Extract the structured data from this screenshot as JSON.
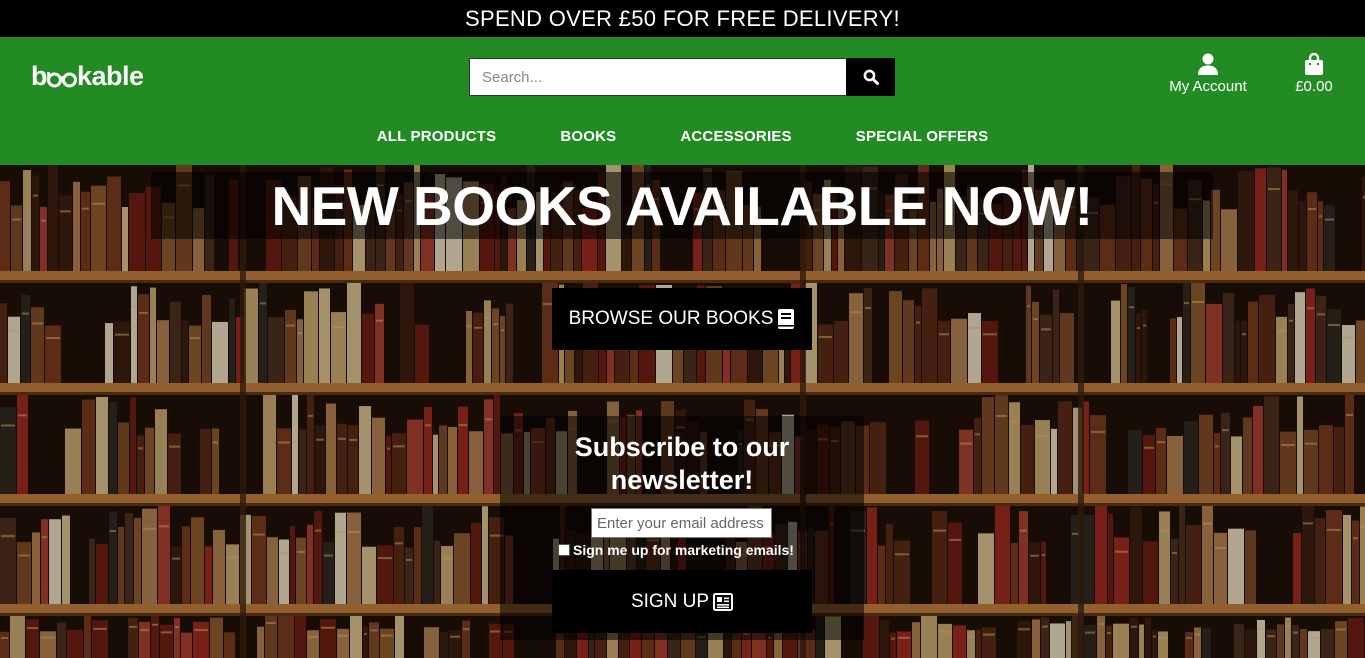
{
  "banner": {
    "text": "SPEND OVER £50 FOR FREE DELIVERY!"
  },
  "header": {
    "logo_prefix": "b",
    "logo_suffix": "kable",
    "search_placeholder": "Search...",
    "search_icon": "search-icon",
    "account_label": "My Account",
    "account_icon": "user-icon",
    "bag_total": "£0.00",
    "bag_icon": "shopping-bag-icon"
  },
  "nav": {
    "items": [
      "ALL PRODUCTS",
      "BOOKS",
      "ACCESSORIES",
      "SPECIAL OFFERS"
    ]
  },
  "hero": {
    "headline": "NEW BOOKS AVAILABLE NOW!",
    "browse_label": "BROWSE OUR BOOKS",
    "browse_icon": "book-icon"
  },
  "newsletter": {
    "heading_line1": "Subscribe to our",
    "heading_line2": "newsletter!",
    "email_placeholder": "Enter your email address",
    "consent_label": "Sign me up for marketing emails!",
    "signup_label": "SIGN UP",
    "signup_icon": "newspaper-icon"
  },
  "colors": {
    "header_green": "#238b23",
    "banner_black": "#000000",
    "button_black": "#000000"
  }
}
